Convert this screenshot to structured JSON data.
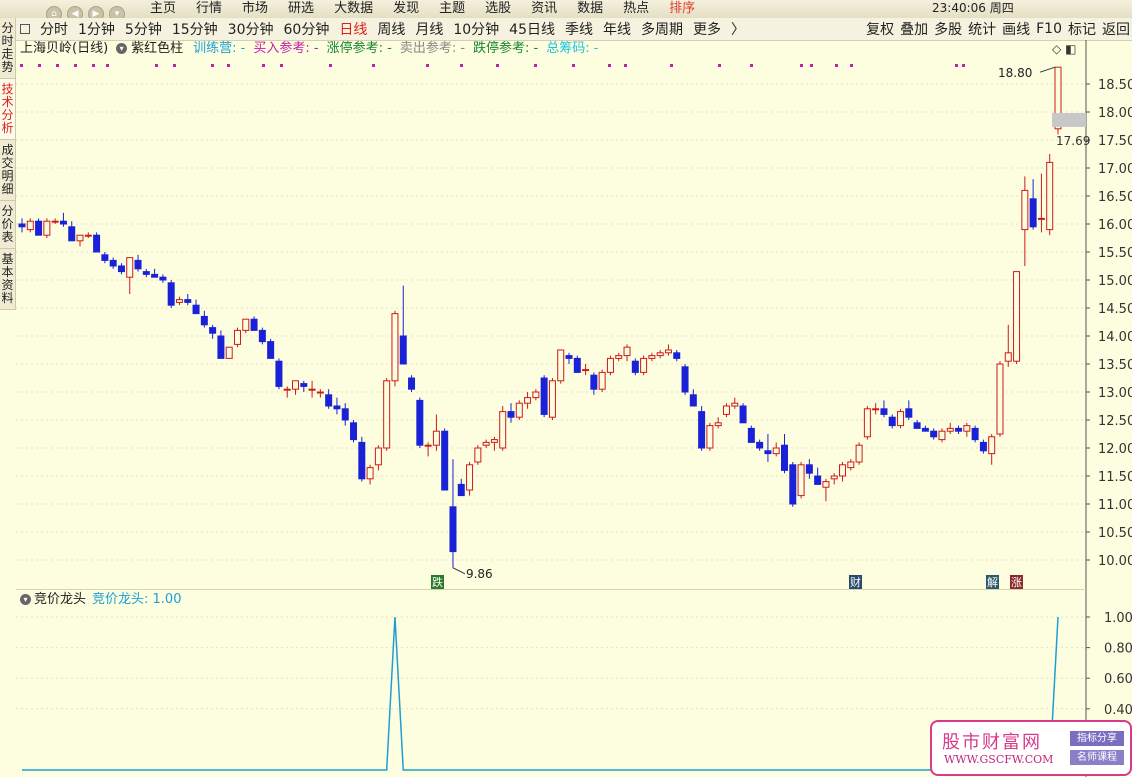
{
  "topnav": {
    "items": [
      "主页",
      "行情",
      "市场",
      "研选",
      "大数据",
      "发现",
      "主题",
      "选股",
      "资讯",
      "数据",
      "热点",
      "排序"
    ],
    "active_index": 11,
    "clock": "23:40:06 周四"
  },
  "periods": {
    "items": [
      "分时",
      "1分钟",
      "5分钟",
      "15分钟",
      "30分钟",
      "60分钟",
      "日线",
      "周线",
      "月线",
      "10分钟",
      "45日线",
      "季线",
      "年线",
      "多周期",
      "更多"
    ],
    "active_index": 6,
    "tools": [
      "复权",
      "叠加",
      "多股",
      "统计",
      "画线",
      "F10",
      "标记",
      "返回"
    ]
  },
  "sidebar": {
    "tabs": [
      "分时走势",
      "技术分析",
      "成交明细",
      "分价表",
      "基本资料"
    ],
    "active_index": 1
  },
  "main_info": {
    "stock": "上海贝岭(日线)",
    "indicator": "紫红色柱",
    "fields": [
      {
        "label": "训练营: -",
        "color": "#1e9fd3"
      },
      {
        "label": "买入参考: -",
        "color": "#c21fa8"
      },
      {
        "label": "涨停参考: -",
        "color": "#18862f"
      },
      {
        "label": "卖出参考: -",
        "color": "#888888"
      },
      {
        "label": "跌停参考: -",
        "color": "#18862f"
      },
      {
        "label": "总筹码: -",
        "color": "#1ec3d9"
      }
    ]
  },
  "chart_data": [
    {
      "type": "candlestick",
      "title": "上海贝岭(日线)",
      "ylim": [
        9.7,
        19.0
      ],
      "yticks": [
        "18.50",
        "18.00",
        "17.50",
        "17.00",
        "16.50",
        "16.00",
        "15.50",
        "15.00",
        "14.50",
        "14.00",
        "13.50",
        "13.00",
        "12.50",
        "12.00",
        "11.50",
        "11.00",
        "10.50",
        "10.00"
      ],
      "up_color": "#d01a1a",
      "down_color": "#1a22d8",
      "annotations": {
        "high": "18.80",
        "low": "9.86",
        "last": "17.69"
      },
      "markers": [
        "跌",
        "财",
        "解",
        "涨"
      ],
      "candles": [
        [
          16.0,
          16.1,
          15.85,
          15.95
        ],
        [
          15.9,
          16.1,
          15.85,
          16.05
        ],
        [
          16.05,
          16.1,
          15.8,
          15.8
        ],
        [
          15.8,
          16.1,
          15.75,
          16.05
        ],
        [
          16.05,
          16.1,
          16.0,
          16.05
        ],
        [
          16.05,
          16.2,
          15.95,
          16.0
        ],
        [
          15.95,
          16.05,
          15.7,
          15.7
        ],
        [
          15.7,
          15.8,
          15.6,
          15.8
        ],
        [
          15.8,
          15.85,
          15.75,
          15.8
        ],
        [
          15.8,
          15.85,
          15.5,
          15.5
        ],
        [
          15.45,
          15.5,
          15.3,
          15.35
        ],
        [
          15.35,
          15.4,
          15.2,
          15.25
        ],
        [
          15.25,
          15.3,
          15.1,
          15.15
        ],
        [
          15.05,
          15.4,
          14.75,
          15.4
        ],
        [
          15.35,
          15.45,
          15.15,
          15.2
        ],
        [
          15.15,
          15.2,
          15.05,
          15.1
        ],
        [
          15.1,
          15.2,
          15.05,
          15.05
        ],
        [
          15.05,
          15.1,
          14.95,
          15.0
        ],
        [
          14.95,
          15.0,
          14.5,
          14.55
        ],
        [
          14.6,
          14.7,
          14.55,
          14.65
        ],
        [
          14.65,
          14.75,
          14.55,
          14.6
        ],
        [
          14.55,
          14.65,
          14.4,
          14.4
        ],
        [
          14.35,
          14.45,
          14.15,
          14.2
        ],
        [
          14.15,
          14.2,
          13.95,
          14.05
        ],
        [
          14.0,
          14.1,
          13.6,
          13.6
        ],
        [
          13.6,
          13.8,
          13.6,
          13.8
        ],
        [
          13.85,
          14.15,
          13.8,
          14.1
        ],
        [
          14.1,
          14.3,
          14.05,
          14.3
        ],
        [
          14.3,
          14.35,
          14.1,
          14.1
        ],
        [
          14.1,
          14.15,
          13.85,
          13.9
        ],
        [
          13.9,
          13.95,
          13.6,
          13.6
        ],
        [
          13.55,
          13.6,
          13.05,
          13.1
        ],
        [
          13.05,
          13.1,
          12.9,
          13.05
        ],
        [
          13.05,
          13.2,
          12.95,
          13.2
        ],
        [
          13.15,
          13.2,
          13.0,
          13.1
        ],
        [
          13.05,
          13.2,
          12.9,
          13.05
        ],
        [
          13.0,
          13.05,
          12.9,
          13.0
        ],
        [
          12.95,
          13.05,
          12.7,
          12.75
        ],
        [
          12.75,
          12.9,
          12.6,
          12.7
        ],
        [
          12.7,
          12.8,
          12.4,
          12.5
        ],
        [
          12.45,
          12.5,
          12.1,
          12.15
        ],
        [
          12.1,
          12.2,
          11.4,
          11.45
        ],
        [
          11.45,
          11.7,
          11.35,
          11.65
        ],
        [
          11.7,
          12.05,
          11.6,
          12.0
        ],
        [
          12.0,
          13.25,
          11.95,
          13.2
        ],
        [
          13.2,
          14.45,
          13.1,
          14.4
        ],
        [
          14.0,
          14.9,
          13.5,
          13.5
        ],
        [
          13.25,
          13.3,
          13.0,
          13.05
        ],
        [
          12.85,
          12.9,
          12.0,
          12.05
        ],
        [
          12.05,
          12.1,
          11.85,
          12.05
        ],
        [
          12.05,
          12.6,
          11.95,
          12.3
        ],
        [
          12.3,
          12.35,
          11.25,
          11.25
        ],
        [
          10.95,
          11.8,
          9.86,
          10.15
        ],
        [
          11.35,
          11.45,
          11.15,
          11.15
        ],
        [
          11.25,
          11.75,
          11.15,
          11.7
        ],
        [
          11.75,
          12.05,
          11.7,
          12.0
        ],
        [
          12.05,
          12.15,
          12.0,
          12.1
        ],
        [
          12.1,
          12.2,
          11.95,
          12.15
        ],
        [
          12.0,
          12.75,
          11.95,
          12.65
        ],
        [
          12.65,
          12.8,
          12.45,
          12.55
        ],
        [
          12.55,
          12.85,
          12.5,
          12.8
        ],
        [
          12.8,
          13.0,
          12.7,
          12.9
        ],
        [
          12.9,
          13.05,
          12.85,
          13.0
        ],
        [
          13.25,
          13.3,
          12.55,
          12.6
        ],
        [
          12.55,
          13.25,
          12.5,
          13.2
        ],
        [
          13.2,
          13.75,
          13.15,
          13.75
        ],
        [
          13.65,
          13.7,
          13.5,
          13.6
        ],
        [
          13.6,
          13.65,
          13.35,
          13.35
        ],
        [
          13.4,
          13.5,
          13.3,
          13.4
        ],
        [
          13.3,
          13.35,
          12.95,
          13.05
        ],
        [
          13.05,
          13.4,
          13.0,
          13.35
        ],
        [
          13.35,
          13.65,
          13.3,
          13.6
        ],
        [
          13.6,
          13.7,
          13.55,
          13.65
        ],
        [
          13.65,
          13.85,
          13.55,
          13.8
        ],
        [
          13.55,
          13.6,
          13.3,
          13.35
        ],
        [
          13.35,
          13.65,
          13.3,
          13.6
        ],
        [
          13.6,
          13.7,
          13.55,
          13.65
        ],
        [
          13.65,
          13.75,
          13.6,
          13.7
        ],
        [
          13.7,
          13.85,
          13.65,
          13.75
        ],
        [
          13.7,
          13.75,
          13.55,
          13.6
        ],
        [
          13.45,
          13.5,
          12.95,
          13.0
        ],
        [
          12.95,
          13.05,
          12.75,
          12.75
        ],
        [
          12.65,
          12.75,
          11.95,
          12.0
        ],
        [
          12.0,
          12.45,
          11.95,
          12.4
        ],
        [
          12.4,
          12.55,
          12.35,
          12.45
        ],
        [
          12.6,
          12.8,
          12.55,
          12.75
        ],
        [
          12.75,
          12.9,
          12.7,
          12.8
        ],
        [
          12.75,
          12.8,
          12.45,
          12.45
        ],
        [
          12.35,
          12.4,
          12.1,
          12.1
        ],
        [
          12.1,
          12.15,
          11.95,
          12.0
        ],
        [
          11.95,
          12.25,
          11.75,
          11.9
        ],
        [
          11.9,
          12.1,
          11.85,
          12.0
        ],
        [
          12.05,
          12.25,
          11.55,
          11.6
        ],
        [
          11.7,
          11.75,
          10.95,
          11.0
        ],
        [
          11.15,
          11.75,
          11.1,
          11.7
        ],
        [
          11.7,
          11.8,
          11.45,
          11.55
        ],
        [
          11.5,
          11.65,
          11.35,
          11.35
        ],
        [
          11.3,
          11.45,
          11.05,
          11.4
        ],
        [
          11.45,
          11.55,
          11.35,
          11.5
        ],
        [
          11.5,
          11.75,
          11.4,
          11.7
        ],
        [
          11.65,
          11.8,
          11.6,
          11.75
        ],
        [
          11.75,
          12.1,
          11.7,
          12.05
        ],
        [
          12.2,
          12.75,
          12.15,
          12.7
        ],
        [
          12.7,
          12.8,
          12.6,
          12.7
        ],
        [
          12.7,
          12.85,
          12.55,
          12.6
        ],
        [
          12.55,
          12.6,
          12.35,
          12.4
        ],
        [
          12.4,
          12.7,
          12.35,
          12.65
        ],
        [
          12.7,
          12.85,
          12.5,
          12.55
        ],
        [
          12.45,
          12.5,
          12.35,
          12.35
        ],
        [
          12.35,
          12.4,
          12.3,
          12.3
        ],
        [
          12.3,
          12.35,
          12.15,
          12.2
        ],
        [
          12.15,
          12.35,
          12.1,
          12.3
        ],
        [
          12.3,
          12.45,
          12.25,
          12.35
        ],
        [
          12.35,
          12.4,
          12.25,
          12.3
        ],
        [
          12.3,
          12.45,
          12.2,
          12.4
        ],
        [
          12.35,
          12.4,
          12.1,
          12.15
        ],
        [
          12.1,
          12.15,
          11.9,
          11.95
        ],
        [
          11.9,
          12.25,
          11.7,
          12.2
        ],
        [
          12.25,
          13.55,
          12.2,
          13.5
        ],
        [
          13.55,
          14.2,
          13.45,
          13.7
        ],
        [
          13.55,
          15.15,
          13.5,
          15.15
        ],
        [
          15.9,
          16.85,
          15.25,
          16.6
        ],
        [
          16.45,
          16.8,
          15.9,
          15.95
        ],
        [
          16.1,
          16.9,
          15.85,
          16.1
        ],
        [
          15.9,
          17.25,
          15.8,
          17.1
        ],
        [
          17.7,
          18.8,
          17.6,
          18.8
        ]
      ]
    },
    {
      "type": "line",
      "title": "竞价龙头",
      "series": [
        {
          "name": "竞价龙头",
          "color": "#1e9fd3",
          "values": [
            0,
            0,
            0,
            0,
            0,
            0,
            0,
            0,
            0,
            0,
            0,
            0,
            0,
            0,
            0,
            0,
            0,
            0,
            0,
            0,
            0,
            0,
            0,
            0,
            0,
            0,
            0,
            0,
            0,
            0,
            0,
            0,
            0,
            0,
            0,
            0,
            0,
            0,
            0,
            0,
            0,
            0,
            0,
            0,
            0,
            1,
            0,
            0,
            0,
            0,
            0,
            0,
            0,
            0,
            0,
            0,
            0,
            0,
            0,
            0,
            0,
            0,
            0,
            0,
            0,
            0,
            0,
            0,
            0,
            0,
            0,
            0,
            0,
            0,
            0,
            0,
            0,
            0,
            0,
            0,
            0,
            0,
            0,
            0,
            0,
            0,
            0,
            0,
            0,
            0,
            0,
            0,
            0,
            0,
            0,
            0,
            0,
            0,
            0,
            0,
            0,
            0,
            0,
            0,
            0,
            0,
            0,
            0,
            0,
            0,
            0,
            0,
            0,
            0,
            0,
            0,
            0,
            0,
            0,
            0,
            0,
            0,
            0,
            0,
            0,
            1
          ]
        }
      ],
      "ylim": [
        0,
        1.05
      ],
      "yticks": [
        "1.00",
        "0.80",
        "0.60",
        "0.40"
      ]
    }
  ],
  "sub_info": {
    "title": "竞价龙头",
    "value_label": "竞价龙头: 1.00"
  },
  "watermark": {
    "title": "股市财富网",
    "url": "WWW.GSCFW.COM",
    "badge1": "指标分享",
    "badge2": "名师课程"
  }
}
